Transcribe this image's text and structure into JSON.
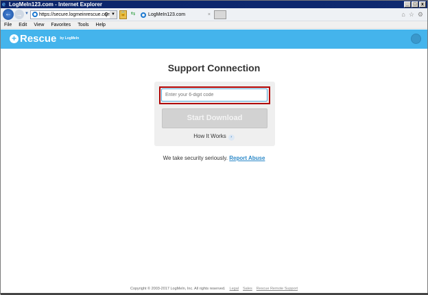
{
  "window": {
    "title": "LogMeIn123.com - Internet Explorer"
  },
  "browser": {
    "url": "https://secure.logmeinrescue.com/",
    "tab_title": "LogMeIn123.com",
    "menu": [
      "File",
      "Edit",
      "View",
      "Favorites",
      "Tools",
      "Help"
    ]
  },
  "brand": {
    "name": "Rescue",
    "by": "by LogMeIn"
  },
  "main": {
    "title": "Support Connection",
    "code_placeholder": "Enter your 6-digit code",
    "start_label": "Start Download",
    "how_label": "How It Works",
    "security_text": "We take security seriously.",
    "report_label": "Report Abuse"
  },
  "footer": {
    "copyright": "Copyright © 2003-2017 LogMeIn, Inc. All rights reserved.",
    "links": [
      "Legal",
      "Sales",
      "Rescue Remote Support"
    ]
  }
}
